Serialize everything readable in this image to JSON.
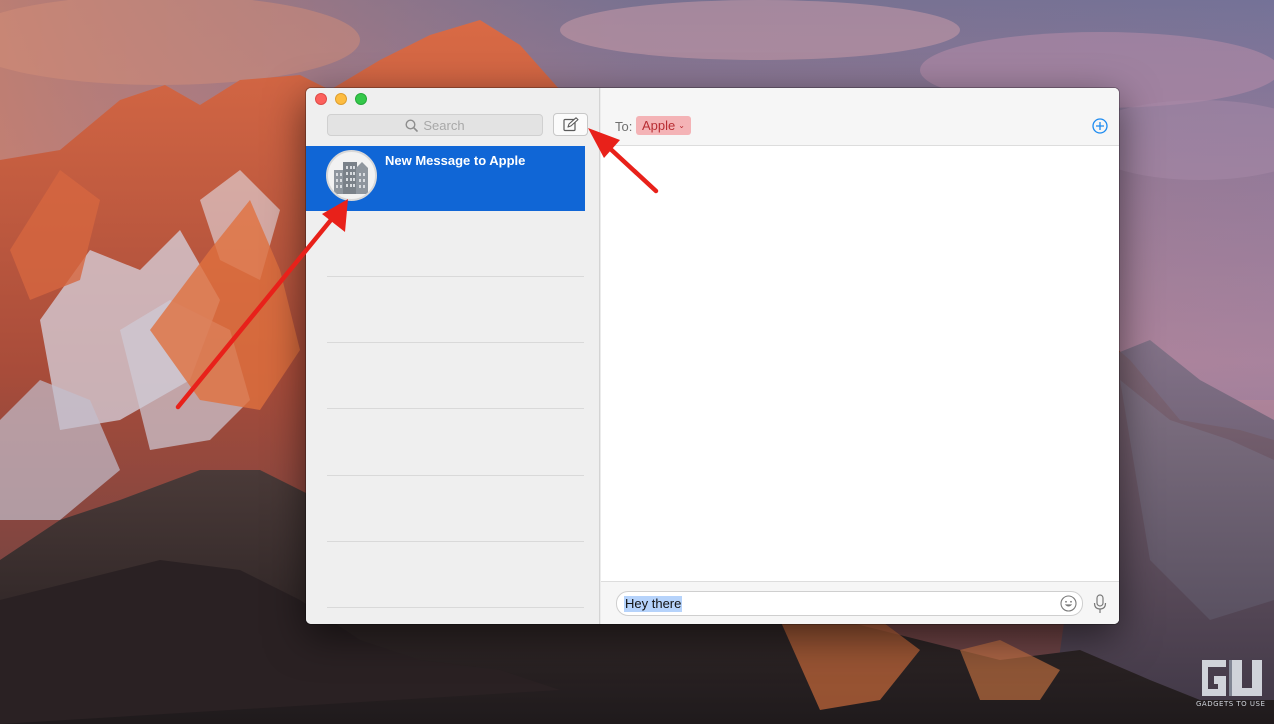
{
  "window": {
    "search_placeholder": "Search",
    "compose_icon": "compose-icon",
    "conversation": {
      "title": "New Message to Apple",
      "avatar_icon": "business-building-icon",
      "selected_color": "#1066d6"
    },
    "header": {
      "to_label": "To:",
      "recipient": "Apple",
      "recipient_chevron": "⌄",
      "add_icon": "plus-circle-icon"
    },
    "composer": {
      "message_text": "Hey there",
      "emoji_icon": "emoji-icon",
      "mic_icon": "microphone-icon"
    }
  },
  "colors": {
    "accent_blue": "#1066d6",
    "recipient_bg": "#f4b3b6",
    "recipient_text": "#b82d33",
    "arrow_red": "#e8211a"
  },
  "watermark": {
    "logo_text": "GU",
    "caption": "GADGETS TO USE"
  }
}
